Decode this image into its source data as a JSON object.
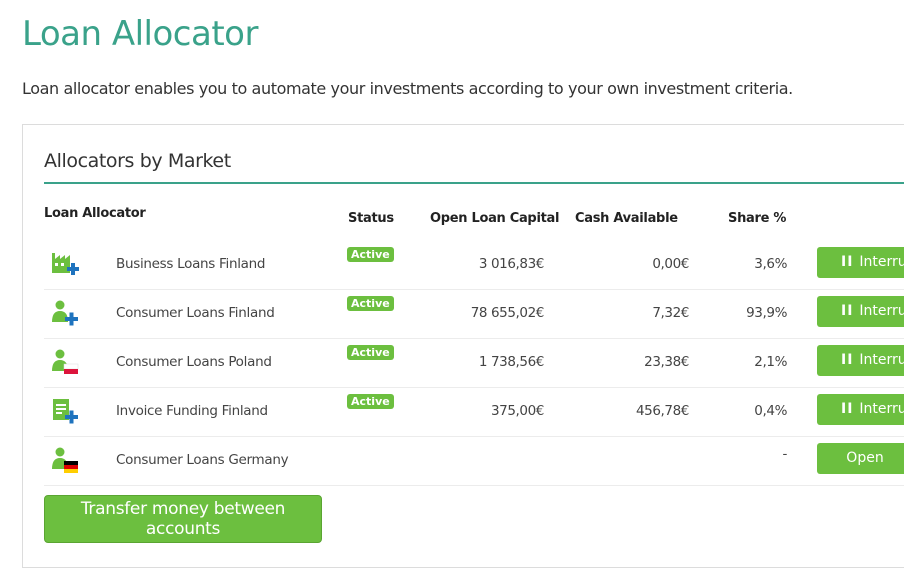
{
  "page": {
    "title": "Loan Allocator",
    "intro": "Loan allocator enables you to automate your investments according to your own investment criteria."
  },
  "panel": {
    "title": "Allocators by Market",
    "headers": {
      "allocator": "Loan Allocator",
      "status": "Status",
      "open_capital": "Open Loan Capital",
      "cash": "Cash Available",
      "share": "Share %"
    },
    "rows": [
      {
        "name": "Business Loans Finland",
        "icon": "business-loan-finland-icon",
        "status": "Active",
        "open_capital": "3 016,83€",
        "cash": "0,00€",
        "share": "3,6%",
        "action": "Interrupt"
      },
      {
        "name": "Consumer Loans Finland",
        "icon": "consumer-loan-finland-icon",
        "status": "Active",
        "open_capital": "78 655,02€",
        "cash": "7,32€",
        "share": "93,9%",
        "action": "Interrupt"
      },
      {
        "name": "Consumer Loans Poland",
        "icon": "consumer-loan-poland-icon",
        "status": "Active",
        "open_capital": "1 738,56€",
        "cash": "23,38€",
        "share": "2,1%",
        "action": "Interrupt"
      },
      {
        "name": "Invoice Funding Finland",
        "icon": "invoice-funding-finland-icon",
        "status": "Active",
        "open_capital": "375,00€",
        "cash": "456,78€",
        "share": "0,4%",
        "action": "Interrupt"
      },
      {
        "name": "Consumer Loans Germany",
        "icon": "consumer-loan-germany-icon",
        "status": "",
        "open_capital": "",
        "cash": "",
        "share": "-",
        "action": "Open"
      }
    ],
    "pause_glyph": "II",
    "transfer_label": "Transfer money between accounts"
  },
  "colors": {
    "accent": "#3aa28a",
    "button_green": "#6cbf3f",
    "icon_blue": "#1e73be",
    "flag_red": "#dc143c",
    "flag_black": "#000000",
    "flag_gold": "#ffce00"
  }
}
